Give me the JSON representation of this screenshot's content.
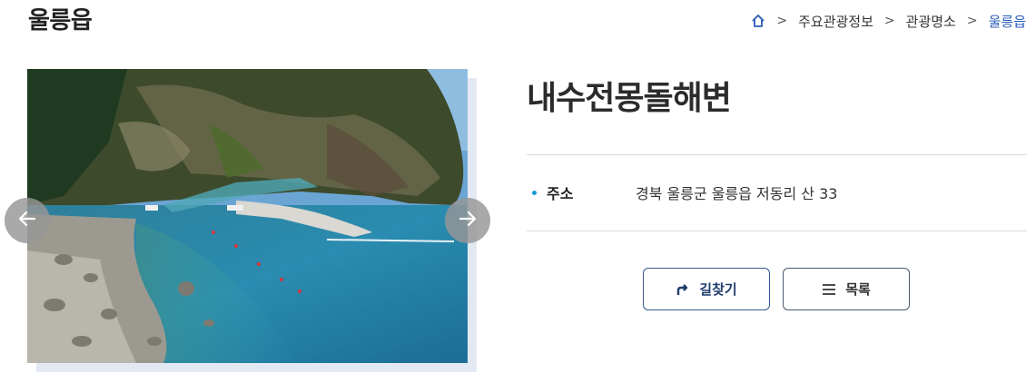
{
  "header": {
    "title": "울릉읍",
    "breadcrumb": {
      "home_icon": "home-icon",
      "items": [
        "주요관광정보",
        "관광명소",
        "울릉읍"
      ],
      "separator": ">"
    }
  },
  "gallery": {
    "prev_icon": "arrow-left-icon",
    "next_icon": "arrow-right-icon",
    "image_subject": "rocky beach with turquoise sea and cliff"
  },
  "spot": {
    "name": "내수전몽돌해변",
    "address_label": "주소",
    "address_value": "경북 울릉군 울릉읍 저동리 산 33"
  },
  "actions": {
    "route_label": "길찾기",
    "route_icon": "turn-right-arrow-icon",
    "list_label": "목록",
    "list_icon": "menu-lines-icon"
  },
  "colors": {
    "accent": "#2a5bb8",
    "bullet": "#1a9bd7",
    "button_border": "#355a8f"
  }
}
